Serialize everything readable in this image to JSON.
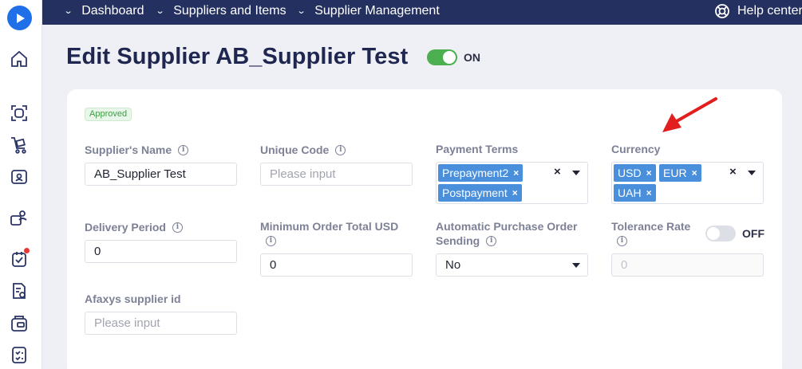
{
  "topbar": {
    "breadcrumbs": [
      "Dashboard",
      "Suppliers and Items",
      "Supplier Management"
    ],
    "help_label": "Help center"
  },
  "header": {
    "title": "Edit Supplier AB_Supplier Test",
    "status_toggle": {
      "label": "ON",
      "on": true
    }
  },
  "badge": "Approved",
  "fields": {
    "supplier_name": {
      "label": "Supplier's Name",
      "value": "AB_Supplier Test"
    },
    "unique_code": {
      "label": "Unique Code",
      "placeholder": "Please input"
    },
    "payment_terms": {
      "label": "Payment Terms",
      "tags": [
        "Prepayment2",
        "Postpayment"
      ]
    },
    "currency": {
      "label": "Currency",
      "tags": [
        "USD",
        "EUR",
        "UAH"
      ]
    },
    "delivery_period": {
      "label": "Delivery Period",
      "value": "0"
    },
    "min_order_total": {
      "label": "Minimum Order Total USD",
      "value": "0"
    },
    "auto_po_sending": {
      "label_line1": "Automatic Purchase Order",
      "label_line2": "Sending",
      "value": "No"
    },
    "tolerance_rate": {
      "label": "Tolerance Rate",
      "toggle_label": "OFF",
      "on": false,
      "placeholder": "0"
    },
    "afaxys_supplier_id": {
      "label": "Afaxys supplier id",
      "placeholder": "Please input"
    }
  },
  "colors": {
    "topbar": "#24305f",
    "accent": "#1e6fe8",
    "tag": "#4a8fdb",
    "toggle_on": "#4caf50",
    "annotation_arrow": "#e31e1e"
  },
  "sidebar_icons": [
    "home-icon",
    "scan-icon",
    "cart-icon",
    "supplier-icon",
    "team-icon",
    "task-icon",
    "invoice-icon",
    "wallet-icon",
    "checklist-icon"
  ]
}
